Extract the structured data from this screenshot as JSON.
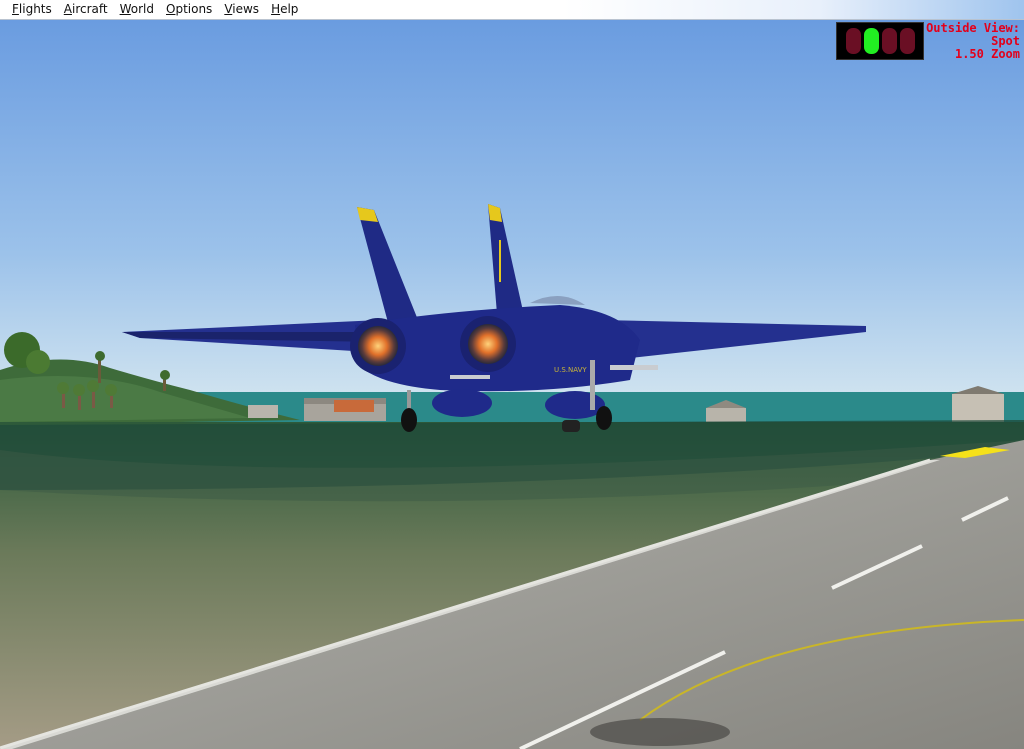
{
  "menu": {
    "items": [
      {
        "first": "F",
        "rest": "lights"
      },
      {
        "first": "A",
        "rest": "ircraft"
      },
      {
        "first": "W",
        "rest": "orld"
      },
      {
        "first": "O",
        "rest": "ptions"
      },
      {
        "first": "V",
        "rest": "iews"
      },
      {
        "first": "H",
        "rest": "elp"
      }
    ]
  },
  "hud": {
    "line1": "Outside View:",
    "line2": "Spot",
    "line3": "1.50 Zoom",
    "lights_on_index": 1
  },
  "colors": {
    "jet_body": "#1f2a8a",
    "tail_tip": "#e6c81c",
    "sky_top": "#6e9fe0",
    "sky_bottom": "#cfe1ef",
    "sea": "#2a8a8c",
    "runway": "#9a9a98",
    "hud_text": "#e3001b",
    "light_on": "#22ee22",
    "light_off": "#6a0f24"
  }
}
